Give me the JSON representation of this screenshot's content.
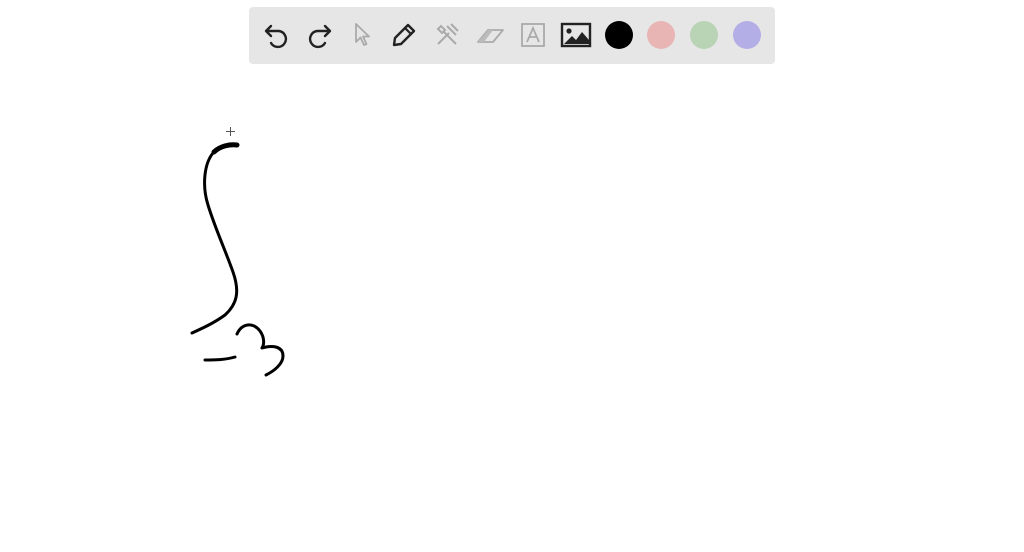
{
  "toolbar": {
    "tools": [
      {
        "name": "undo-icon",
        "enabled": true
      },
      {
        "name": "redo-icon",
        "enabled": true
      },
      {
        "name": "select-pointer-icon",
        "enabled": false
      },
      {
        "name": "pen-icon",
        "enabled": true,
        "active": true
      },
      {
        "name": "tools-icon",
        "enabled": false
      },
      {
        "name": "eraser-icon",
        "enabled": false
      },
      {
        "name": "text-icon",
        "enabled": false
      },
      {
        "name": "image-icon",
        "enabled": true
      }
    ],
    "colors": {
      "black": "#000000",
      "pink": "#e8b4b4",
      "green": "#b9d3b5",
      "lavender": "#b3aee6"
    },
    "active_color": "black"
  },
  "colors": {
    "toolbar_bg": "#e6e6e6",
    "icon_enabled": "#222222",
    "icon_disabled": "#aaaaaa",
    "ink": "#000000"
  }
}
